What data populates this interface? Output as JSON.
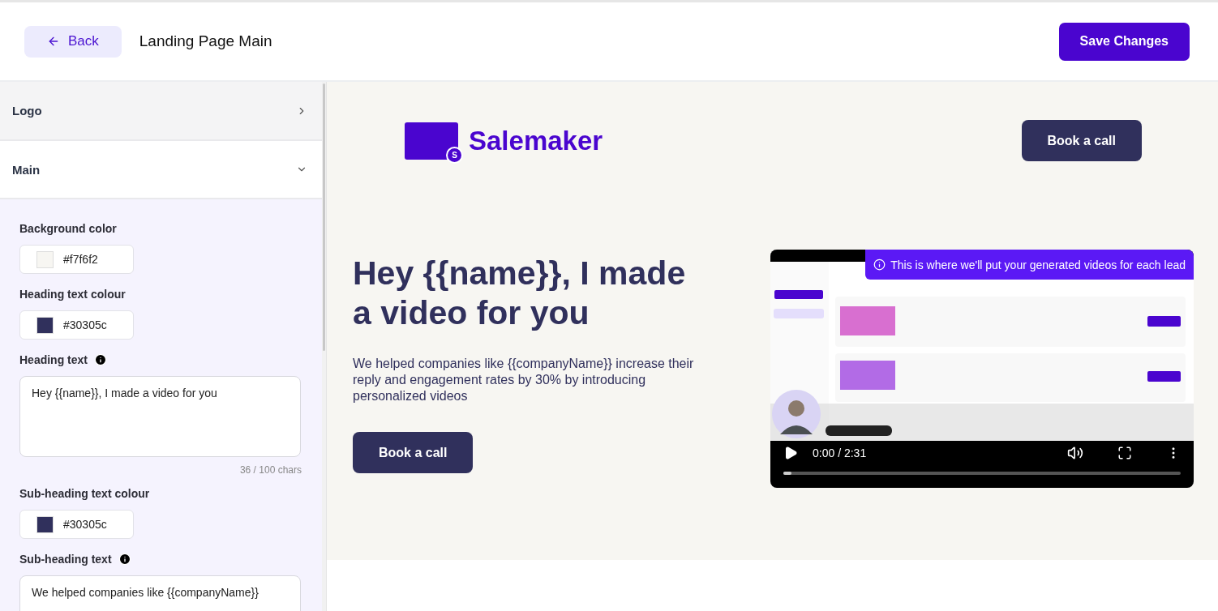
{
  "header": {
    "back_button": {
      "label": "Back"
    },
    "title": "Landing Page Main",
    "save_button": "Save Changes"
  },
  "sidebar": {
    "sections": [
      {
        "title": "Logo",
        "expanded": false
      },
      {
        "title": "Main",
        "expanded": true
      }
    ],
    "fields": [
      {
        "kind": "color",
        "label": "Background color",
        "value": "#f7f6f2"
      },
      {
        "kind": "color",
        "label": "Heading text colour",
        "value": "#30305c"
      },
      {
        "kind": "text",
        "label": "Heading text",
        "info": true,
        "value": "Hey {{name}}, I made a video for you",
        "counter": "36 / 100 chars"
      },
      {
        "kind": "color",
        "label": "Sub-heading text colour",
        "value": "#30305c"
      },
      {
        "kind": "text",
        "label": "Sub-heading text",
        "info": true,
        "value": "We helped companies like {{companyName}}"
      }
    ]
  },
  "preview": {
    "logo": {
      "badge": "S",
      "name": "Salemaker"
    },
    "nav_button": "Book a call",
    "heading": "Hey {{name}}, I made a video for you",
    "subheading": "We helped companies like {{companyName}} increase their reply and engagement rates by 30% by introducing personalized videos",
    "cta_button": "Book a call",
    "video": {
      "tooltip": "This is where we'll put your generated videos for each lead",
      "time": "0:00 / 2:31",
      "playing": false,
      "level": 0.02
    }
  }
}
